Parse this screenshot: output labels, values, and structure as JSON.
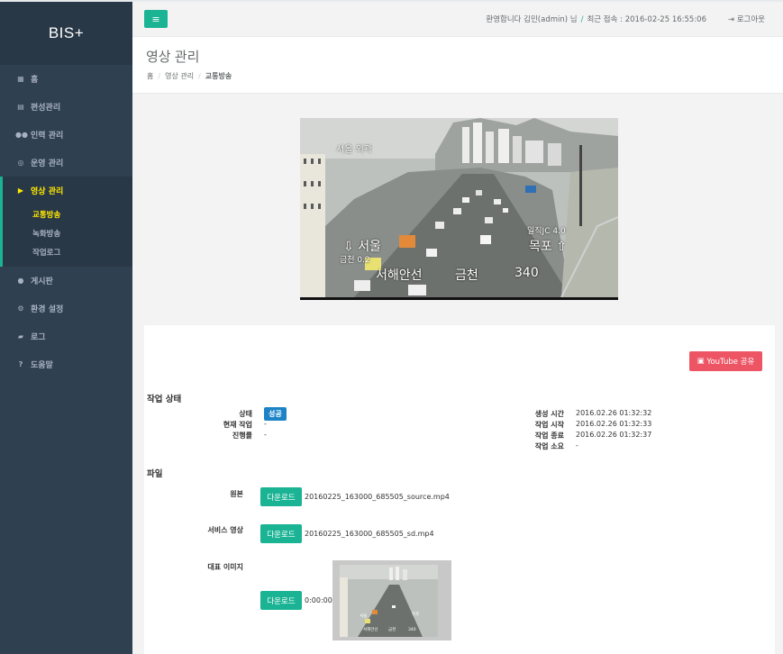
{
  "app": {
    "brand": "BIS+"
  },
  "sidebar": {
    "items": [
      {
        "label": "홈",
        "icon": "grid-icon",
        "glyph": "▦"
      },
      {
        "label": "편성관리",
        "icon": "calendar-icon",
        "glyph": "▤"
      },
      {
        "label": "인력 관리",
        "icon": "users-icon",
        "glyph": "●●"
      },
      {
        "label": "운영 관리",
        "icon": "eye-icon",
        "glyph": "◎"
      },
      {
        "label": "영상 관리",
        "icon": "youtube-play-icon",
        "glyph": "▶"
      },
      {
        "label": "게시판",
        "icon": "comment-icon",
        "glyph": "●"
      },
      {
        "label": "환경 설정",
        "icon": "cogs-icon",
        "glyph": "⚙"
      },
      {
        "label": "로그",
        "icon": "book-icon",
        "glyph": "▰"
      },
      {
        "label": "도움말",
        "icon": "question-icon",
        "glyph": "?"
      }
    ],
    "subitems": [
      {
        "label": "교통방송"
      },
      {
        "label": "녹화방송"
      },
      {
        "label": "작업로그"
      }
    ]
  },
  "topbar": {
    "menu_glyph": "≡",
    "welcome": "환영합니다 김민(admin) 님",
    "separator": "/",
    "last_login": "최근 접속 : 2016-02-25 16:55:06",
    "logout_glyph": "⇥",
    "logout": "로그아웃"
  },
  "page": {
    "title": "영상 관리",
    "breadcrumb": [
      "홈",
      "영상 관리",
      "교통방송"
    ]
  },
  "video": {
    "captions": {
      "top_left": "서울 외곽",
      "left_dir": "서울",
      "left_sub": "금천 0.2",
      "right_top": "일직JC 4.0",
      "right_dir": "목포",
      "bottom_name": "서해안선",
      "bottom_place": "금천",
      "bottom_num": "340"
    }
  },
  "panel": {
    "youtube_button": "YouTube 공유",
    "status_title": "작업 상태",
    "status": {
      "left": [
        {
          "label": "상태",
          "value": "성공"
        },
        {
          "label": "현재 작업",
          "value": "-"
        },
        {
          "label": "진행률",
          "value": "-"
        }
      ],
      "right": [
        {
          "label": "생성 시간",
          "value": "2016.02.26 01:32:32"
        },
        {
          "label": "작업 시작",
          "value": "2016.02.26 01:32:33"
        },
        {
          "label": "작업 종료",
          "value": "2016.02.26 01:32:37"
        },
        {
          "label": "작업 소요",
          "value": "-"
        }
      ]
    },
    "files_title": "파일",
    "files": [
      {
        "label": "원본",
        "button": "다운로드",
        "name": "20160225_163000_685505_source.mp4"
      },
      {
        "label": "서비스 영상",
        "button": "다운로드",
        "name": "20160225_163000_685505_sd.mp4"
      },
      {
        "label": "대표 이미지",
        "button": "다운로드",
        "name": "0:00:00"
      }
    ]
  },
  "colors": {
    "sidebar": "#2f4050",
    "accent": "#1ab394",
    "active_text": "#ffe900",
    "danger": "#ed5565",
    "badge": "#1c84c6"
  }
}
